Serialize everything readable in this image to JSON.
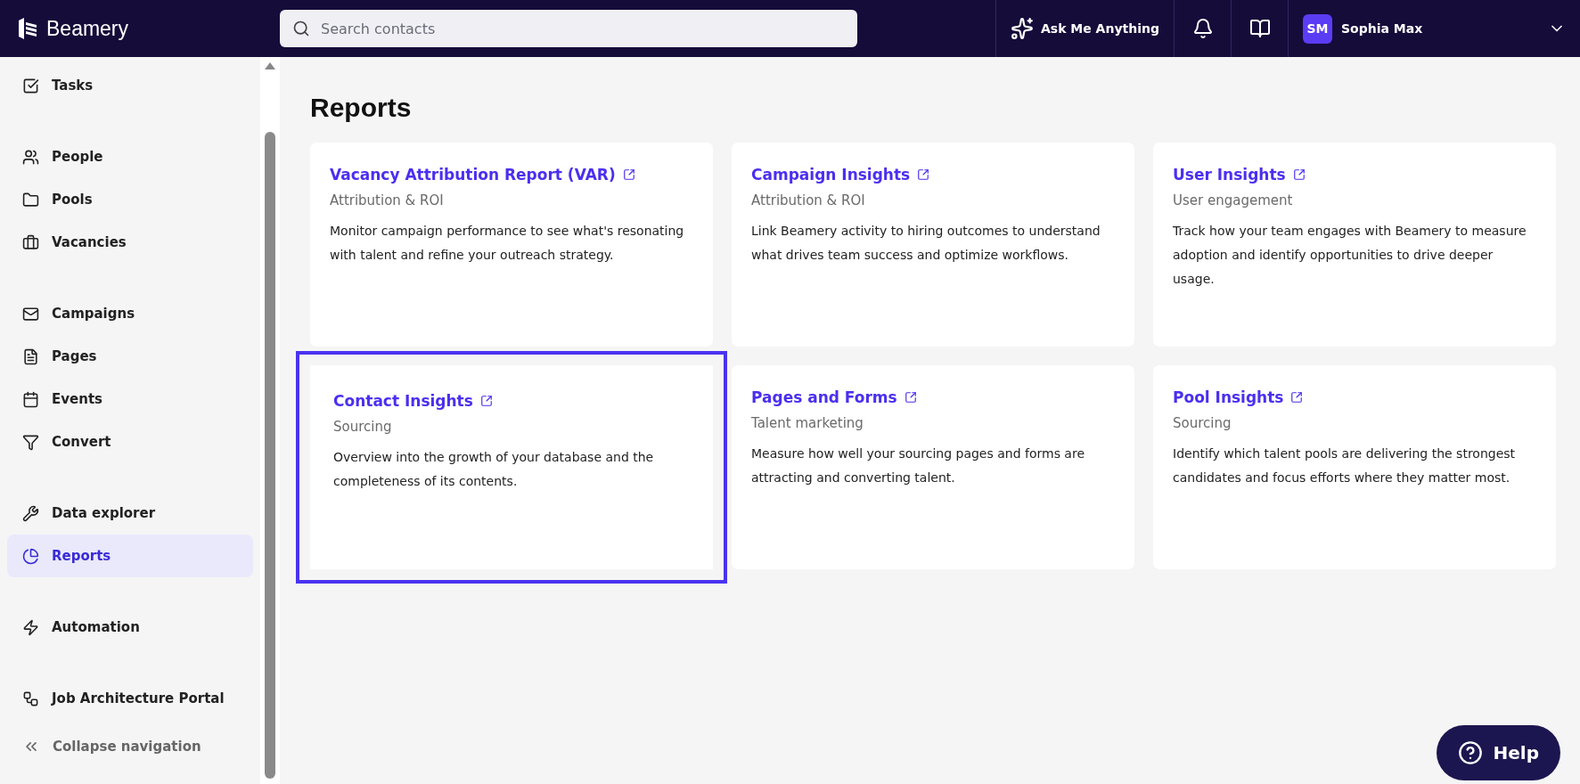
{
  "header": {
    "brand": "Beamery",
    "search": {
      "placeholder": "Search contacts"
    },
    "ask_button": "Ask Me Anything",
    "user": {
      "initials": "SM",
      "name": "Sophia Max"
    }
  },
  "sidebar": {
    "groups": [
      [
        {
          "label": "Tasks",
          "selected": false
        }
      ],
      [
        {
          "label": "People",
          "selected": false
        },
        {
          "label": "Pools",
          "selected": false
        },
        {
          "label": "Vacancies",
          "selected": false
        }
      ],
      [
        {
          "label": "Campaigns",
          "selected": false
        },
        {
          "label": "Pages",
          "selected": false
        },
        {
          "label": "Events",
          "selected": false
        },
        {
          "label": "Convert",
          "selected": false
        }
      ],
      [
        {
          "label": "Data explorer",
          "selected": false
        },
        {
          "label": "Reports",
          "selected": true
        }
      ],
      [
        {
          "label": "Automation",
          "selected": false
        }
      ],
      [
        {
          "label": "Job Architecture Portal",
          "selected": false
        }
      ]
    ],
    "collapse": "Collapse navigation"
  },
  "page": {
    "title": "Reports",
    "cards": [
      {
        "title": "Vacancy Attribution Report (VAR)",
        "category": "Attribution & ROI",
        "description": "Monitor campaign performance to see what's resonating with talent and refine your outreach strategy.",
        "focused": false
      },
      {
        "title": "Campaign Insights",
        "category": "Attribution & ROI",
        "description": "Link Beamery activity to hiring outcomes to understand what drives team success and optimize workflows.",
        "focused": false
      },
      {
        "title": "User Insights",
        "category": "User engagement",
        "description": "Track how your team engages with Beamery to measure adoption and identify opportunities to drive deeper usage.",
        "focused": false
      },
      {
        "title": "Contact Insights",
        "category": "Sourcing",
        "description": "Overview into the growth of your database and the completeness of its contents.",
        "focused": true
      },
      {
        "title": "Pages and Forms",
        "category": "Talent marketing",
        "description": "Measure how well your sourcing pages and forms are attracting and converting talent.",
        "focused": false
      },
      {
        "title": "Pool Insights",
        "category": "Sourcing",
        "description": "Identify which talent pools are delivering the strongest candidates and focus efforts where they matter most.",
        "focused": false
      }
    ]
  },
  "help_button": "Help"
}
